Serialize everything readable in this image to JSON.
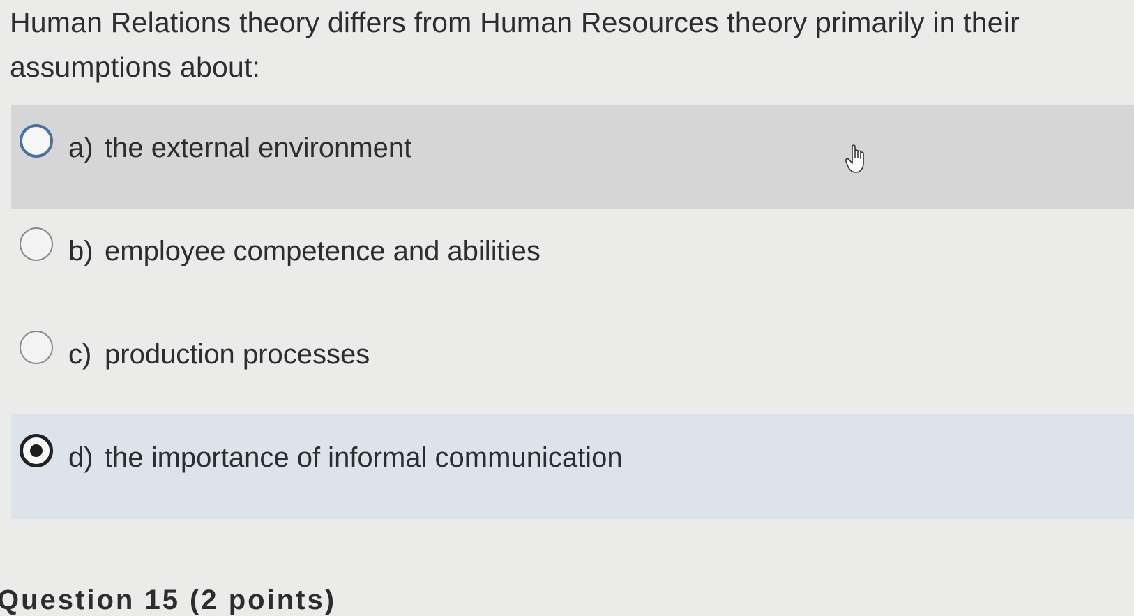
{
  "question": {
    "text": "Human Relations theory differs from Human Resources theory primarily in their assumptions about:"
  },
  "options": [
    {
      "letter": "a)",
      "text": "the external environment",
      "state": "hovered"
    },
    {
      "letter": "b)",
      "text": "employee competence and abilities",
      "state": "default"
    },
    {
      "letter": "c)",
      "text": "production processes",
      "state": "default"
    },
    {
      "letter": "d)",
      "text": "the importance of informal communication",
      "state": "selected"
    }
  ],
  "next_question": {
    "label": "Question 15 (2 points)"
  },
  "icons": {
    "cursor": "hand-pointer-icon"
  },
  "colors": {
    "hover_background": "#d6d6d6",
    "selected_background": "#dde3ea",
    "radio_hover_border": "#4a6fa0",
    "selected_dot": "#1c1c1c"
  }
}
